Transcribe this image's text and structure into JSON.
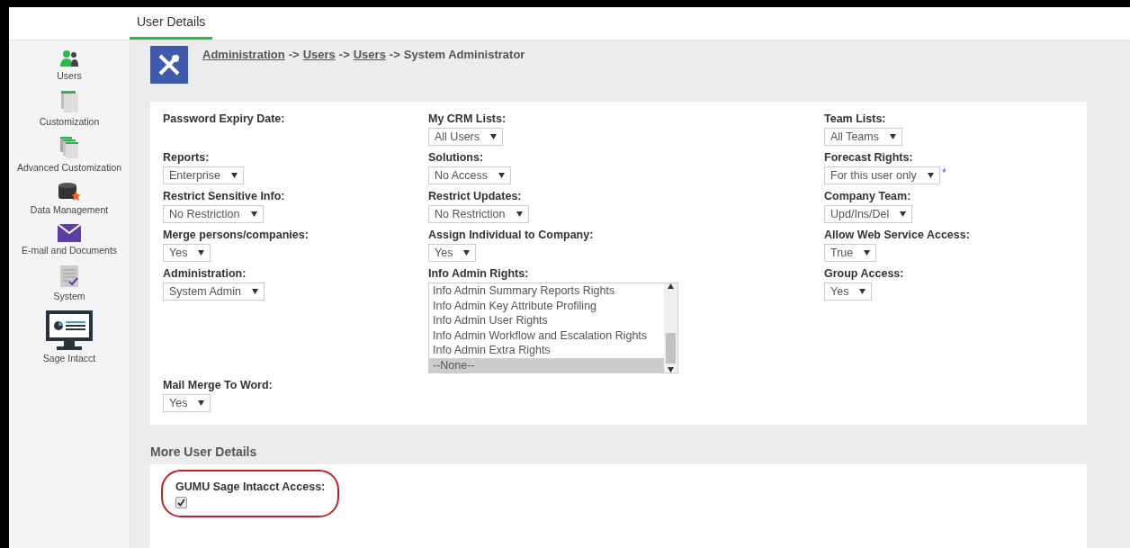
{
  "tabs": [
    {
      "label": "User Details",
      "selected": true
    }
  ],
  "sidebar": {
    "items": [
      {
        "label": "Users"
      },
      {
        "label": "Customization"
      },
      {
        "label": "Advanced Customization"
      },
      {
        "label": "Data Management"
      },
      {
        "label": "E-mail and Documents"
      },
      {
        "label": "System"
      },
      {
        "label": "Sage Intacct"
      }
    ]
  },
  "breadcrumb": [
    {
      "text": "Administration",
      "link": true
    },
    {
      "text": "->",
      "link": false
    },
    {
      "text": "Users",
      "link": true
    },
    {
      "text": "->",
      "link": false
    },
    {
      "text": "Users",
      "link": true
    },
    {
      "text": "->",
      "link": false
    },
    {
      "text": "System Administrator",
      "link": false
    }
  ],
  "form": {
    "rows": [
      [
        {
          "label": "Password Expiry Date:",
          "kind": "text"
        },
        {
          "label": "My CRM Lists:",
          "kind": "select",
          "value": "All Users"
        },
        {
          "label": "Team Lists:",
          "kind": "select",
          "value": "All Teams"
        }
      ],
      [
        {
          "label": "Reports:",
          "kind": "select",
          "value": "Enterprise"
        },
        {
          "label": "Solutions:",
          "kind": "select",
          "value": "No Access"
        },
        {
          "label": "Forecast Rights:",
          "kind": "select",
          "value": "For this user only",
          "suffix": "*"
        }
      ],
      [
        {
          "label": "Restrict Sensitive Info:",
          "kind": "select",
          "value": "No Restriction"
        },
        {
          "label": "Restrict Updates:",
          "kind": "select",
          "value": "No Restriction"
        },
        {
          "label": "Company Team:",
          "kind": "select",
          "value": "Upd/Ins/Del"
        }
      ],
      [
        {
          "label": "Merge persons/companies:",
          "kind": "select",
          "value": "Yes"
        },
        {
          "label": "Assign Individual to Company:",
          "kind": "select",
          "value": "Yes"
        },
        {
          "label": "Allow Web Service Access:",
          "kind": "select",
          "value": "True"
        }
      ],
      [
        {
          "label": "Administration:",
          "kind": "select",
          "value": "System Admin"
        },
        {
          "label": "Info Admin Rights:",
          "kind": "listbox",
          "options": [
            {
              "text": "Info Admin Summary Reports Rights",
              "selected": false
            },
            {
              "text": "Info Admin Key Attribute Profiling",
              "selected": false
            },
            {
              "text": "Info Admin User Rights",
              "selected": false
            },
            {
              "text": "Info Admin Workflow and Escalation Rights",
              "selected": false
            },
            {
              "text": "Info Admin Extra Rights",
              "selected": false
            },
            {
              "text": "--None--",
              "selected": true
            }
          ]
        },
        {
          "label": "Group Access:",
          "kind": "select",
          "value": "Yes"
        }
      ],
      [
        {
          "label": "Mail Merge To Word:",
          "kind": "select",
          "value": "Yes"
        }
      ]
    ]
  },
  "more": {
    "title": "More User Details",
    "fields": [
      {
        "label": "GUMU Sage Intacct Access:",
        "kind": "checkbox",
        "checked": true,
        "highlighted": true
      }
    ]
  }
}
